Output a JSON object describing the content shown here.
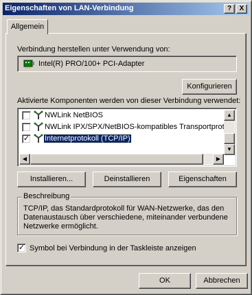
{
  "window": {
    "title": "Eigenschaften von LAN-Verbindung",
    "help_btn": "?",
    "close_btn": "X"
  },
  "tabs": [
    {
      "label": "Allgemein"
    }
  ],
  "connect_using": {
    "label": "Verbindung herstellen unter Verwendung von:",
    "adapter": "Intel(R) PRO/100+ PCI-Adapter",
    "configure_btn": "Konfigurieren"
  },
  "components": {
    "label": "Aktivierte Komponenten werden von dieser Verbindung verwendet:",
    "items": [
      {
        "label": "NWLink NetBIOS",
        "checked": false
      },
      {
        "label": "NWLink IPX/SPX/NetBIOS-kompatibles Transportproto",
        "checked": false
      },
      {
        "label": "Internetprotokoll (TCP/IP)",
        "checked": true,
        "selected": true
      }
    ]
  },
  "buttons": {
    "install": "Installieren...",
    "uninstall": "Deinstallieren",
    "properties": "Eigenschaften",
    "ok": "OK",
    "cancel": "Abbrechen"
  },
  "description": {
    "title": "Beschreibung",
    "line1": "TCP/IP, das Standardprotokoll für WAN-Netzwerke, das den",
    "line2": "Datenaustausch über verschiedene, miteinander verbundene",
    "line3": "Netzwerke ermöglicht."
  },
  "taskbar_option": {
    "label": "Symbol bei Verbindung in der Taskleiste anzeigen",
    "checked": true
  },
  "check_mark": "✓"
}
